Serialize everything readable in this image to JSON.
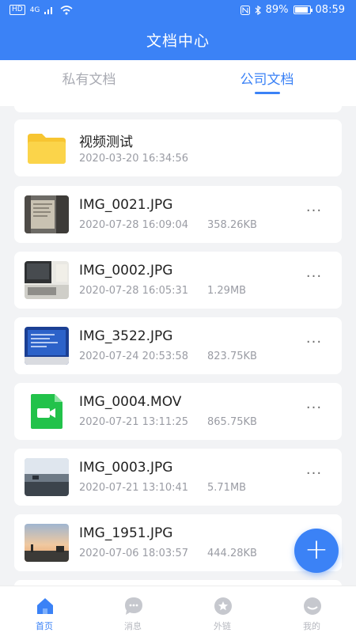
{
  "status_bar": {
    "left_badge": "HD",
    "signal": "4G",
    "battery": "89%",
    "time": "08:59"
  },
  "header": {
    "title": "文档中心"
  },
  "tabs": [
    {
      "label": "私有文档",
      "active": false
    },
    {
      "label": "公司文档",
      "active": true
    }
  ],
  "files": [
    {
      "name": "视频测试",
      "date": "2020-03-20 16:34:56",
      "size": "",
      "kind": "folder",
      "icon": "folder-icon"
    },
    {
      "name": "IMG_0021.JPG",
      "date": "2020-07-28 16:09:04",
      "size": "358.26KB",
      "kind": "image",
      "icon": "image-thumbnail"
    },
    {
      "name": "IMG_0002.JPG",
      "date": "2020-07-28 16:05:31",
      "size": "1.29MB",
      "kind": "image",
      "icon": "image-thumbnail"
    },
    {
      "name": "IMG_3522.JPG",
      "date": "2020-07-24 20:53:58",
      "size": "823.75KB",
      "kind": "image",
      "icon": "image-thumbnail"
    },
    {
      "name": "IMG_0004.MOV",
      "date": "2020-07-21 13:11:25",
      "size": "865.75KB",
      "kind": "video",
      "icon": "video-file-icon"
    },
    {
      "name": "IMG_0003.JPG",
      "date": "2020-07-21 13:10:41",
      "size": "5.71MB",
      "kind": "image",
      "icon": "image-thumbnail"
    },
    {
      "name": "IMG_1951.JPG",
      "date": "2020-07-06 18:03:57",
      "size": "444.28KB",
      "kind": "image",
      "icon": "image-thumbnail"
    }
  ],
  "more_label": "···",
  "fab": {
    "label": "+",
    "icon": "plus-icon"
  },
  "bottom_nav": [
    {
      "label": "首页",
      "icon": "home-icon",
      "active": true
    },
    {
      "label": "消息",
      "icon": "chat-icon",
      "active": false
    },
    {
      "label": "外链",
      "icon": "link-star-icon",
      "active": false
    },
    {
      "label": "我的",
      "icon": "profile-icon",
      "active": false
    }
  ],
  "colors": {
    "accent": "#3b82f6",
    "background": "#f2f3f5",
    "folder": "#f7c531",
    "video": "#22c24a"
  }
}
